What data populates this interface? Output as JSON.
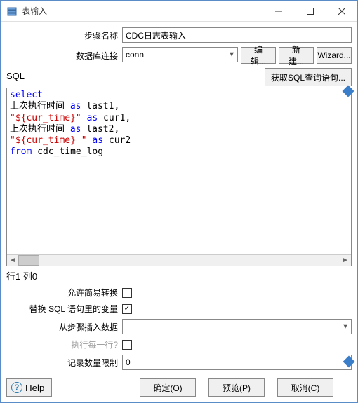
{
  "window": {
    "title": "表输入"
  },
  "fields": {
    "step_name_label": "步骤名称",
    "step_name_value": "CDC日志表输入",
    "db_conn_label": "数据库连接",
    "db_conn_value": "conn",
    "edit_btn": "编辑...",
    "new_btn": "新建...",
    "wizard_btn": "Wizard..."
  },
  "sql": {
    "title": "SQL",
    "get_sql_btn": "获取SQL查询语句...",
    "tokens": [
      {
        "t": "kw",
        "v": "select"
      },
      {
        "t": "nl"
      },
      {
        "t": "txt",
        "v": "上次执行时间 "
      },
      {
        "t": "kw",
        "v": "as"
      },
      {
        "t": "txt",
        "v": " last1,"
      },
      {
        "t": "nl"
      },
      {
        "t": "str",
        "v": "\"${cur_time}\""
      },
      {
        "t": "txt",
        "v": " "
      },
      {
        "t": "kw",
        "v": "as"
      },
      {
        "t": "txt",
        "v": " cur1,"
      },
      {
        "t": "nl"
      },
      {
        "t": "txt",
        "v": "上次执行时间 "
      },
      {
        "t": "kw",
        "v": "as"
      },
      {
        "t": "txt",
        "v": " last2,"
      },
      {
        "t": "nl"
      },
      {
        "t": "str",
        "v": "\"${cur_time} \""
      },
      {
        "t": "txt",
        "v": " "
      },
      {
        "t": "kw",
        "v": "as"
      },
      {
        "t": "txt",
        "v": " cur2"
      },
      {
        "t": "nl"
      },
      {
        "t": "kw",
        "v": "from"
      },
      {
        "t": "txt",
        "v": " cdc_time_log"
      }
    ]
  },
  "status": "行1 列0",
  "options": {
    "allow_lazy_label": "允许简易转换",
    "allow_lazy_checked": false,
    "replace_vars_label": "替换 SQL 语句里的变量",
    "replace_vars_checked": true,
    "insert_from_step_label": "从步骤插入数据",
    "insert_from_step_value": "",
    "exec_each_row_label": "执行每一行?",
    "exec_each_row_checked": false,
    "record_limit_label": "记录数量限制",
    "record_limit_value": "0"
  },
  "buttons": {
    "help": "Help",
    "ok": "确定(O)",
    "preview": "预览(P)",
    "cancel": "取消(C)"
  }
}
